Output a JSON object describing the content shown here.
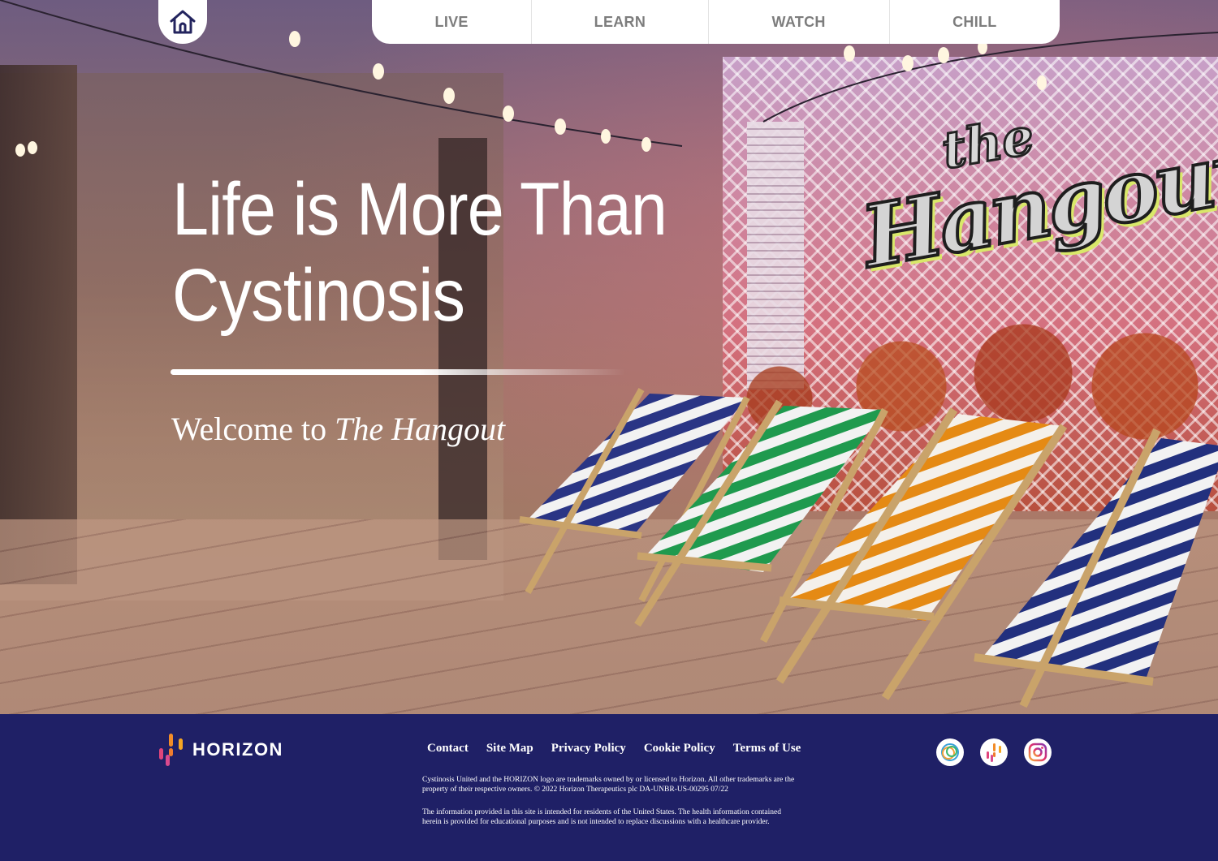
{
  "nav": {
    "home_icon": "home-icon",
    "tabs": [
      {
        "label": "LIVE"
      },
      {
        "label": "LEARN"
      },
      {
        "label": "WATCH"
      },
      {
        "label": "CHILL"
      }
    ]
  },
  "hero": {
    "headline_line1": "Life is More Than",
    "headline_line2": "Cystinosis",
    "welcome_prefix": "Welcome to ",
    "welcome_emphasis": "The Hangout",
    "sign_top": "the",
    "sign_main": "Hangout"
  },
  "footer": {
    "brand": "HORIZON",
    "links": [
      {
        "label": "Contact"
      },
      {
        "label": "Site Map"
      },
      {
        "label": "Privacy Policy"
      },
      {
        "label": "Cookie Policy"
      },
      {
        "label": "Terms of Use"
      }
    ],
    "legal_1": "Cystinosis United and the HORIZON logo are trademarks owned by or licensed to Horizon. All other trademarks are the property of their respective owners. © 2022 Horizon Therapeutics plc  DA-UNBR-US-00295 07/22",
    "legal_2": "The information provided in this site is intended for residents of the United States. The health information contained herein is provided for educational purposes and is not intended to replace discussions with a healthcare provider.",
    "social_icons": [
      "cystinosis-united-icon",
      "horizon-icon",
      "instagram-icon"
    ]
  },
  "colors": {
    "footer_bg": "#1f2066",
    "nav_text": "#7d7d7d",
    "white": "#ffffff"
  }
}
